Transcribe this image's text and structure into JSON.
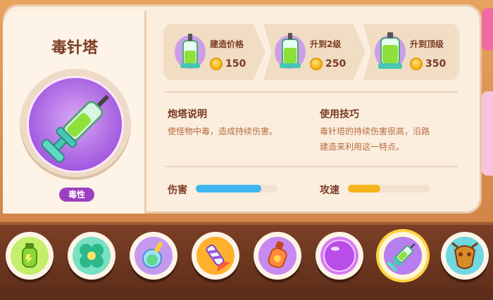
{
  "tower": {
    "name": "毒针塔",
    "tag": "毒性"
  },
  "costs": [
    {
      "label": "建造价格",
      "value": "150"
    },
    {
      "label": "升到2级",
      "value": "250"
    },
    {
      "label": "升到顶级",
      "value": "350"
    }
  ],
  "description": {
    "title": "炮塔说明",
    "text": "使怪物中毒，造成持续伤害。"
  },
  "tips": {
    "title": "使用技巧",
    "line1": "毒针塔的持续伤害很高，沿路",
    "line2": "建造来利用这一特点。"
  },
  "stats": {
    "damage_label": "伤害",
    "damage_level": 0.8,
    "speed_label": "攻速",
    "speed_level": 0.4
  },
  "colors": {
    "damage_bar": "#3fb6f0",
    "speed_bar": "#f7b31c",
    "tag_bg": "#9b3fbf"
  },
  "tray_icons": [
    "potion-icon",
    "clover-icon",
    "flask-icon",
    "rocket-icon",
    "bottle-icon",
    "bubble-icon",
    "syringe-icon",
    "scarab-icon"
  ]
}
